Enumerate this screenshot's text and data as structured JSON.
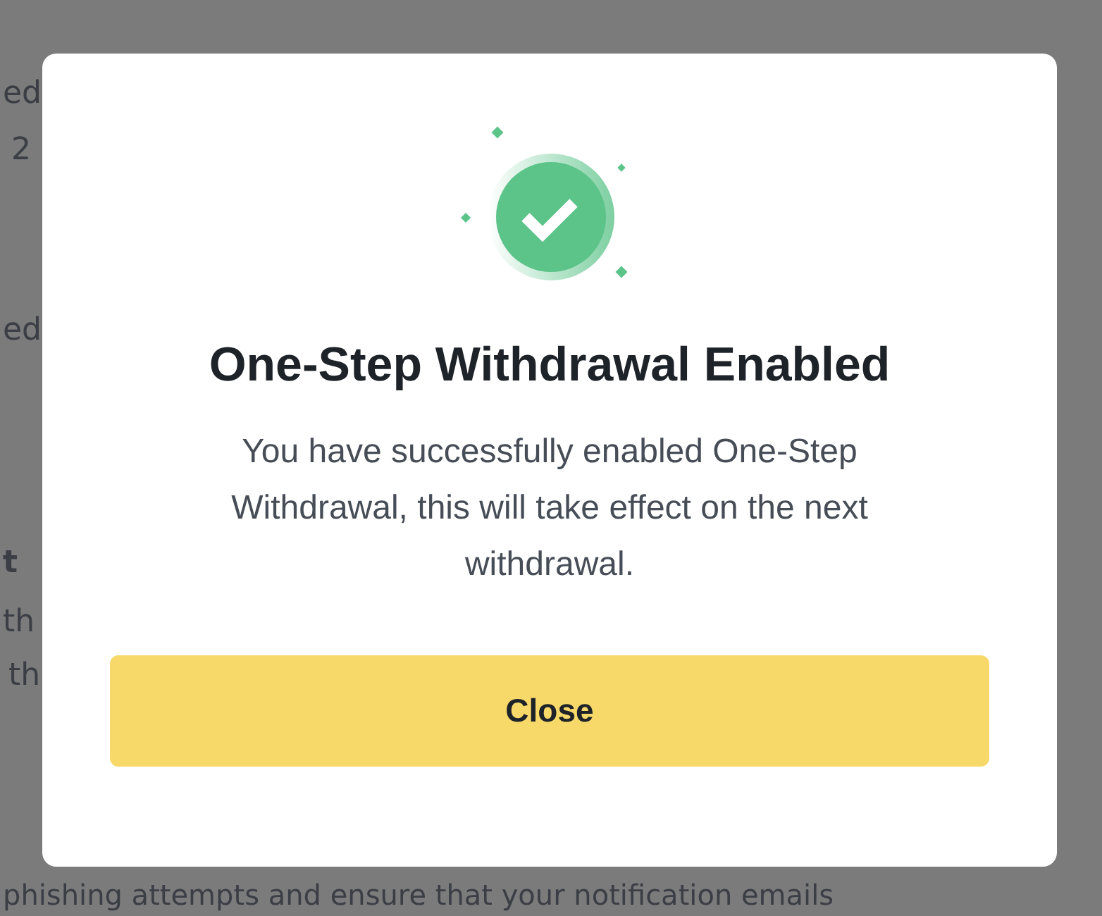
{
  "background_page": {
    "lines": [
      {
        "text": "ed",
        "bold": false
      },
      {
        "text": "2",
        "bold": false
      },
      {
        "text": "ed",
        "bold": false
      },
      {
        "text": "t",
        "bold": true
      },
      {
        "text": "th",
        "bold": false
      },
      {
        "text": "th",
        "bold": false
      }
    ],
    "footer_text": "phishing attempts and ensure that your notification emails"
  },
  "dialog": {
    "title": "One-Step Withdrawal Enabled",
    "message": "You have successfully enabled One-Step Withdrawal, this will take effect on the next withdrawal.",
    "button": "Close"
  }
}
